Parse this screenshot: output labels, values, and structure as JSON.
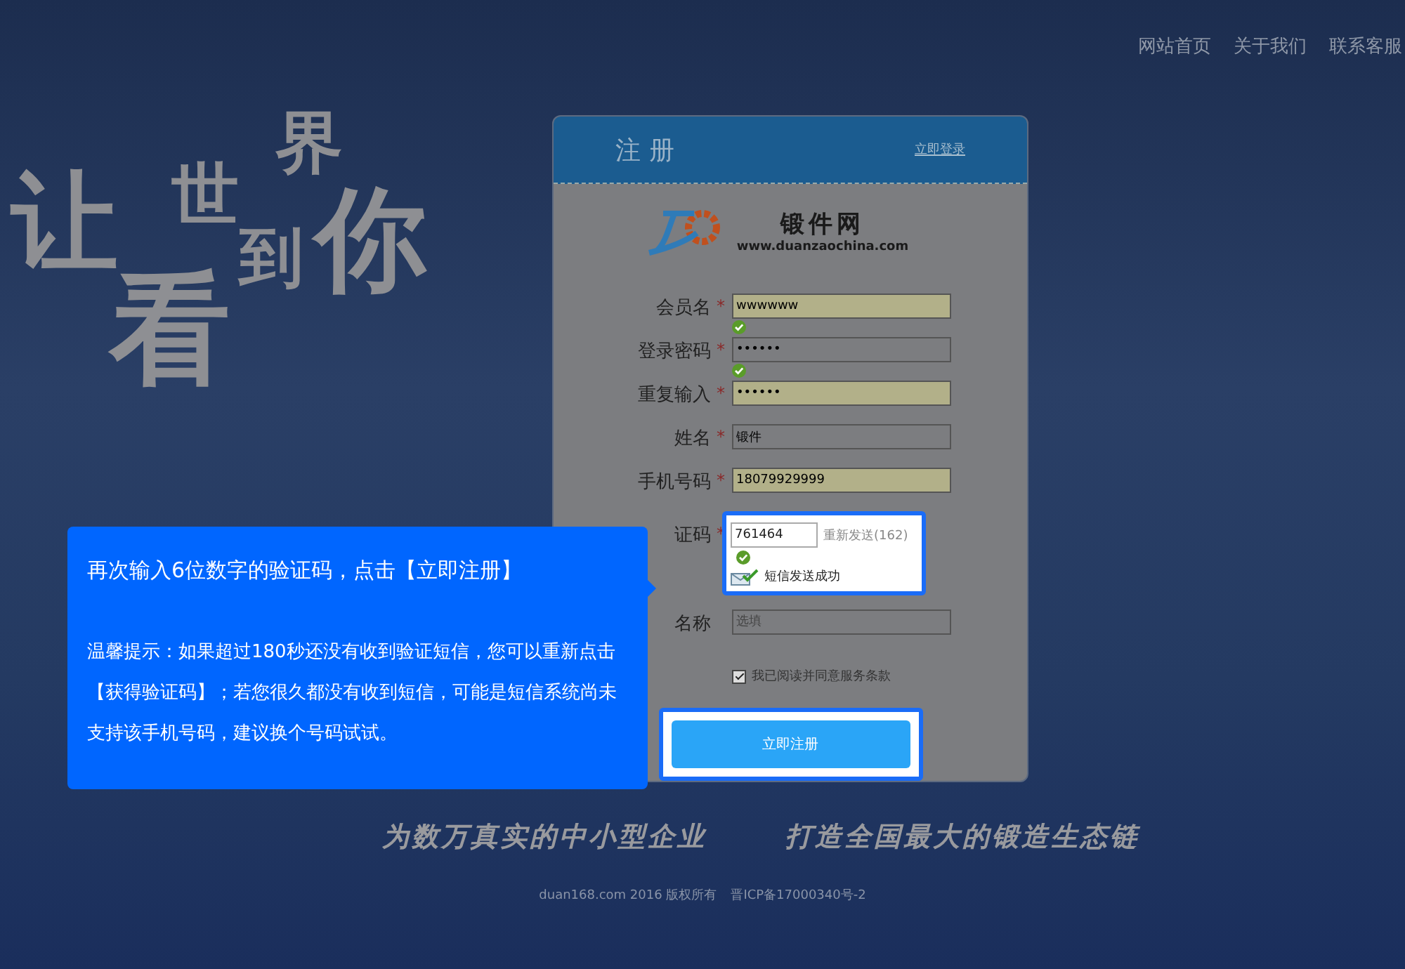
{
  "nav": [
    "网站首页",
    "关于我们",
    "联系客服"
  ],
  "slogan": [
    "让",
    "世",
    "界",
    "看",
    "到",
    "你"
  ],
  "form": {
    "title": "注册",
    "required_mark": "*",
    "login_link": "立即登录",
    "logo": {
      "name": "锻件网",
      "url": "www.duanzaochina.com"
    },
    "fields": [
      {
        "kind": "text",
        "label": "会员名",
        "required": true,
        "value": "wwwwww",
        "autofilled": true,
        "valid": true
      },
      {
        "kind": "text",
        "label": "登录密码",
        "required": true,
        "value": "••••••",
        "autofilled": false,
        "valid": true
      },
      {
        "kind": "text",
        "label": "重复输入",
        "required": true,
        "value": "••••••",
        "autofilled": true,
        "valid": false
      },
      {
        "kind": "text",
        "label": "姓名",
        "required": true,
        "value": "锻件",
        "autofilled": false,
        "valid": false
      },
      {
        "kind": "text",
        "label": "手机号码",
        "required": true,
        "value": "18079929999",
        "autofilled": true,
        "valid": false
      },
      {
        "kind": "code",
        "label": "证码",
        "required": true,
        "value": "761464",
        "resend": "重新发送(162)",
        "status": "短信发送成功",
        "valid": true,
        "highlighted": true
      },
      {
        "kind": "text",
        "label": "名称",
        "required": false,
        "placeholder": "选填",
        "autofilled": false,
        "valid": false
      }
    ],
    "agree": {
      "label": "我已阅读并同意服务条款",
      "checked": true
    },
    "submit": {
      "label": "立即注册",
      "highlighted": true
    }
  },
  "tooltip": {
    "title": "再次输入6位数字的验证码，点击【立即注册】",
    "note": "温馨提示：如果超过180秒还没有收到验证短信，您可以重新点击【获得验证码】；若您很久都没有收到短信，可能是短信系统尚未支持该手机号码，建议换个号码试试。"
  },
  "taglines": [
    "为数万真实的中小型企业",
    "打造全国最大的锻造生态链"
  ],
  "footer": [
    "duan168.com 2016 版权所有",
    "晋ICP备17000340号-2"
  ]
}
